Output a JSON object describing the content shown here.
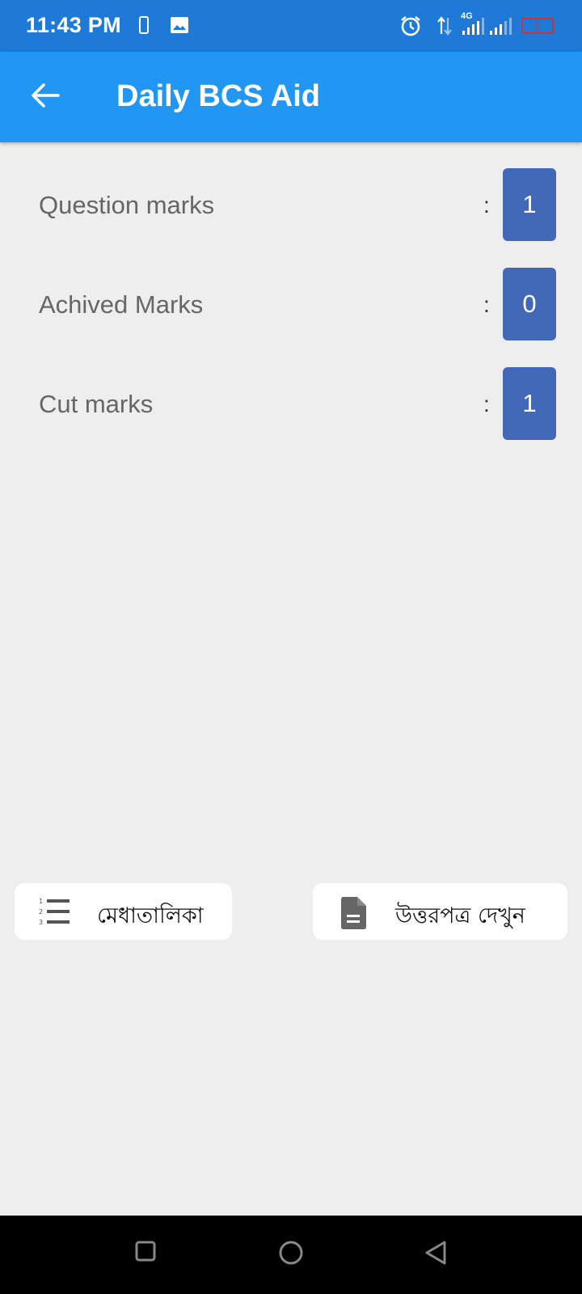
{
  "status_bar": {
    "time": "11:43 PM",
    "network": "4G",
    "battery_level": "5",
    "icons": [
      "phone-outline-icon",
      "image-icon",
      "alarm-icon",
      "data-arrows-icon",
      "signal-icon",
      "signal-icon",
      "battery-icon"
    ]
  },
  "app_bar": {
    "title": "Daily BCS Aid",
    "back_icon": "arrow-back-icon"
  },
  "scores": [
    {
      "label": "Question marks",
      "colon": ":",
      "value": "1"
    },
    {
      "label": "Achived Marks",
      "colon": ":",
      "value": "0"
    },
    {
      "label": "Cut marks",
      "colon": ":",
      "value": "1"
    }
  ],
  "actions": {
    "merit_list": {
      "label": "মেধাতালিকা",
      "icon": "numbered-list-icon"
    },
    "answer_sheet": {
      "label": "উত্তরপত্র দেখুন",
      "icon": "document-icon"
    }
  },
  "nav": {
    "icons": [
      "recents-square-icon",
      "home-circle-icon",
      "back-triangle-icon"
    ]
  },
  "colors": {
    "status_bar": "#1e7ad6",
    "app_bar": "#2196f3",
    "badge": "#4169b8",
    "background": "#eeeeee"
  }
}
